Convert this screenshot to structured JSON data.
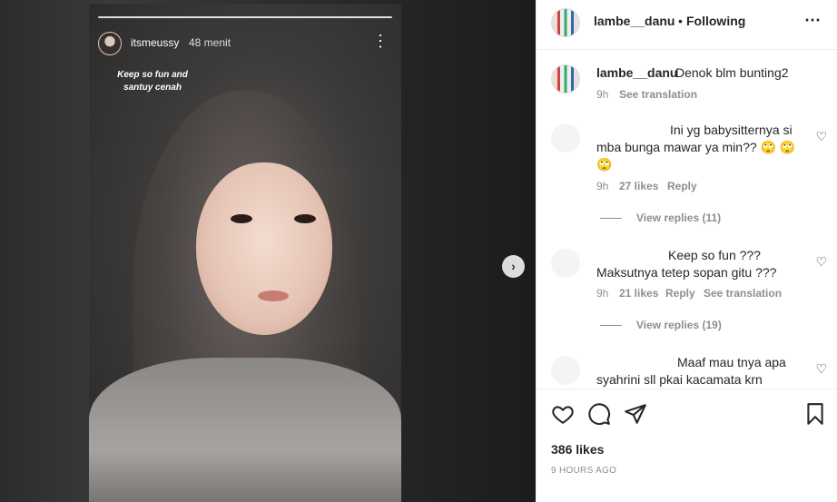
{
  "story": {
    "username": "itsmeussy",
    "time": "48 menit",
    "caption": "Keep so fun and santuy cenah"
  },
  "post": {
    "username": "lambe__danu",
    "follow_status": "Following",
    "separator": "•",
    "caption": "Denok blm bunting2",
    "caption_time": "9h",
    "see_translation": "See translation"
  },
  "comments": [
    {
      "text": "Ini yg babysitternya si mba bunga mawar ya min?? 🙄 🙄 🙄",
      "time": "9h",
      "likes": "27 likes",
      "reply": "Reply",
      "view_replies": "View replies (11)"
    },
    {
      "text": "Keep so fun ??? Maksutnya tetep sopan gitu ???",
      "time": "9h",
      "likes": "21 likes",
      "reply": "Reply",
      "see_translation": "See translation",
      "view_replies": "View replies (19)"
    },
    {
      "text": "Maaf mau tnya apa syahrini sll pkai kacamata krn",
      "time": "",
      "likes": "",
      "reply": ""
    }
  ],
  "footer": {
    "likes": "386 likes",
    "time_ago": "9 HOURS AGO"
  }
}
